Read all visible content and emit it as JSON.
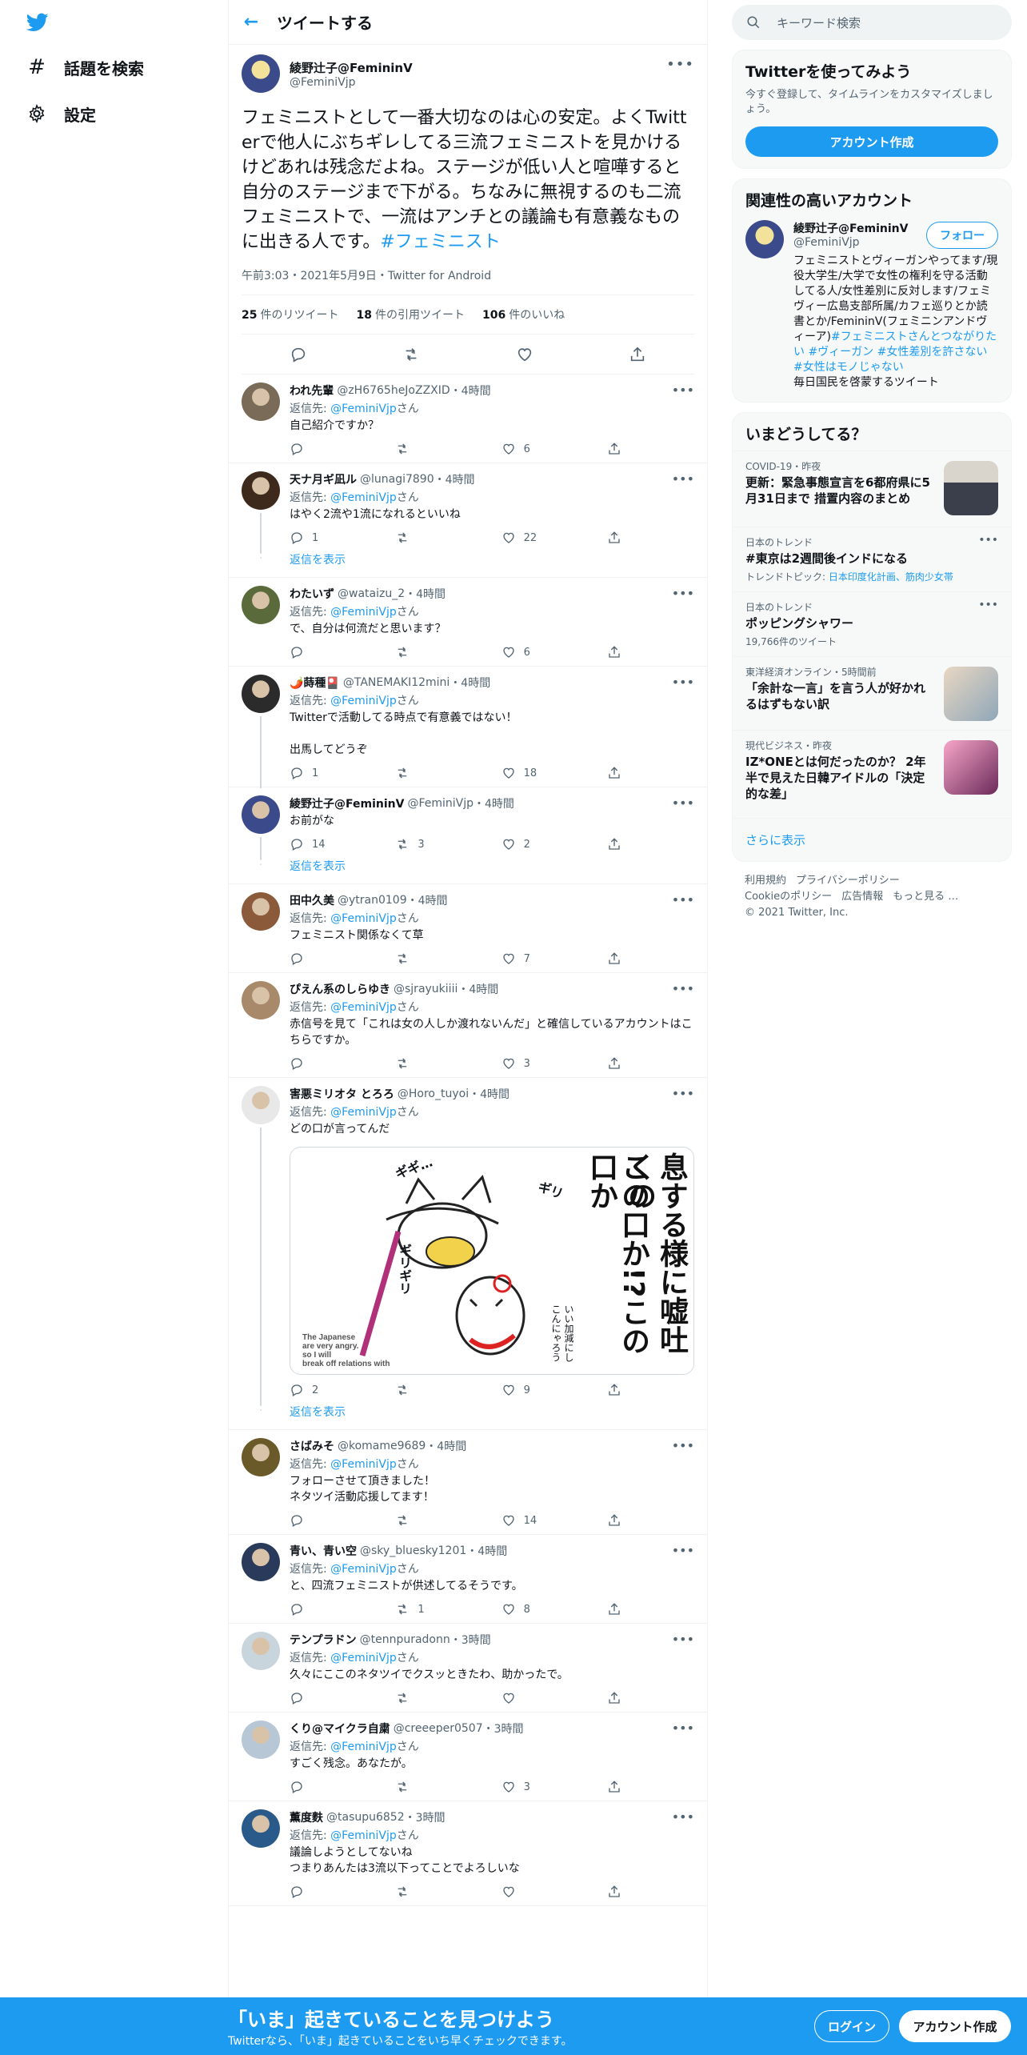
{
  "nav": {
    "explore_label": "話題を検索",
    "settings_label": "設定"
  },
  "header": {
    "title": "ツイートする"
  },
  "main_tweet": {
    "name": "綾野辻子@FemininV",
    "handle": "@FeminiVjp",
    "text": "フェミニストとして一番大切なのは心の安定。よくTwitterで他人にぶちギレしてる三流フェミニストを見かけるけどあれは残念だよね。ステージが低い人と喧嘩すると自分のステージまで下がる。ちなみに無視するのも二流フェミニストで、一流はアンチとの議論も有意義なものに出きる人です。",
    "hashtag": "#フェミニスト",
    "meta": "午前3:03・2021年5月9日・Twitter for Android",
    "retweets_count": "25",
    "retweets_label": "件のリツイート",
    "quotes_count": "18",
    "quotes_label": "件の引用ツイート",
    "likes_count": "106",
    "likes_label": "件のいいね"
  },
  "reply_to_prefix": "返信先:",
  "reply_to_mention": "@FeminiVjp",
  "reply_to_suffix": "さん",
  "show_replies_label": "返信を表示",
  "replies": [
    {
      "name": "われ先輩",
      "handle": "@zH6765heJoZZXID",
      "time": "・4時間",
      "text": "自己紹介ですか？",
      "reply": "",
      "rt": "",
      "like": "6",
      "replyto": true
    },
    {
      "name": "天ナ月ギ凪ル",
      "handle": "@lunagi7890",
      "time": "・4時間",
      "text": "はやく2流や1流になれるといいね",
      "reply": "1",
      "rt": "",
      "like": "22",
      "replyto": true
    },
    {
      "name": "わたいず",
      "handle": "@wataizu_2",
      "time": "・4時間",
      "text": "で、自分は何流だと思います？",
      "reply": "",
      "rt": "",
      "like": "6",
      "replyto": true
    },
    {
      "name": "🌶️蒔種🎴",
      "handle": "@TANEMAKI12mini",
      "time": "・4時間",
      "text": "Twitterで活動してる時点で有意義ではない！\n\n出馬してどうぞ",
      "reply": "1",
      "rt": "",
      "like": "18",
      "replyto": true
    },
    {
      "name": "綾野辻子@FemininV",
      "handle": "@FeminiVjp",
      "time": "・4時間",
      "text": "お前がな",
      "reply": "14",
      "rt": "3",
      "like": "2",
      "replyto": false
    },
    {
      "name": "田中久美",
      "handle": "@ytran0109",
      "time": "・4時間",
      "text": "フェミニスト関係なくて草",
      "reply": "",
      "rt": "",
      "like": "7",
      "replyto": true
    },
    {
      "name": "ぴえん系のしらゆき",
      "handle": "@sjrayukiiii",
      "time": "・4時間",
      "text": "赤信号を見て「これは女の人しか渡れないんだ」と確信しているアカウントはこちらですか。",
      "reply": "",
      "rt": "",
      "like": "3",
      "replyto": true
    },
    {
      "name": "害悪ミリオタ とろろ",
      "handle": "@Horo_tuyoi",
      "time": "・4時間",
      "text": "どの口が言ってんだ",
      "reply": "2",
      "rt": "",
      "like": "9",
      "replyto": true
    },
    {
      "name": "さばみそ",
      "handle": "@komame9689",
      "time": "・4時間",
      "text": "フォローさせて頂きました！\nネタツイ活動応援してます！",
      "reply": "",
      "rt": "",
      "like": "14",
      "replyto": true
    },
    {
      "name": "青い、青い空",
      "handle": "@sky_bluesky1201",
      "time": "・4時間",
      "text": "と、四流フェミニストが供述してるそうです。",
      "reply": "",
      "rt": "1",
      "like": "8",
      "replyto": true
    },
    {
      "name": "テンプラドン",
      "handle": "@tennpuradonn",
      "time": "・3時間",
      "text": "久々にここのネタツイでクスッときたわ、助かったで。",
      "reply": "",
      "rt": "",
      "like": "",
      "replyto": true
    },
    {
      "name": "くり@マイクラ自粛",
      "handle": "@creeeper0507",
      "time": "・3時間",
      "text": "すごく残念。あなたが。",
      "reply": "",
      "rt": "",
      "like": "3",
      "replyto": true
    },
    {
      "name": "薫度麩",
      "handle": "@tasupu6852",
      "time": "・3時間",
      "text": "議論しようとしてないね\nつまりあんたは3流以下ってことでよろしいな",
      "reply": "",
      "rt": "",
      "like": "",
      "replyto": true
    }
  ],
  "media_text": {
    "vertical_1": "息する様に嘘吐くの",
    "vertical_2": "この口か!?この口か",
    "sfx_1": "ギギ…",
    "sfx_2": "ギリ",
    "sfx_3": "ギリギリ",
    "caption": "The Japanese\nare very angry.\nso I will\nbreak off relations with",
    "small_1": "いい加減にし",
    "small_2": "こんにゃろう"
  },
  "right": {
    "search_placeholder": "キーワード検索",
    "signup_title": "Twitterを使ってみよう",
    "signup_sub": "今すぐ登録して、タイムラインをカスタマイズしましょう。",
    "signup_button": "アカウント作成",
    "relevant_title": "関連性の高いアカウント",
    "rel_name": "綾野辻子@FemininV",
    "rel_handle": "@FeminiVjp",
    "follow_label": "フォロー",
    "rel_bio_plain": "フェミニストとヴィーガンやってます/現役大学生/大学で女性の権利を守る活動してる人/女性差別に反対します/フェミヴィー広島支部所属/カフェ巡りとか読書とか/FemininV(フェミニンアンドヴィーア)",
    "rel_bio_tags": "#フェミニストさんとつながりたい #ヴィーガン #女性差別を許さない #女性はモノじゃない",
    "rel_bio_tail": "毎日国民を啓蒙するツイート",
    "trends_title": "いまどうしてる？",
    "trends": [
      {
        "cat": "COVID-19・昨夜",
        "title": "更新：緊急事態宣言を6都府県に5月31日まで 措置内容のまとめ",
        "sub": "",
        "sub_link": ""
      },
      {
        "cat": "日本のトレンド",
        "title": "#東京は2週間後インドになる",
        "sub": "トレンドトピック: ",
        "sub_link": "日本印度化計画、筋肉少女帯"
      },
      {
        "cat": "日本のトレンド",
        "title": "ポッピングシャワー",
        "sub": "19,766件のツイート",
        "sub_link": ""
      },
      {
        "cat": "東洋経済オンライン・5時間前",
        "title": "「余計な一言」を言う人が好かれるはずもない訳",
        "sub": "",
        "sub_link": ""
      },
      {
        "cat": "現代ビジネス・昨夜",
        "title": "IZ*ONEとは何だったのか？ 2年半で見えた日韓アイドルの「決定的な差」",
        "sub": "",
        "sub_link": ""
      }
    ],
    "show_more": "さらに表示",
    "footer": [
      "利用規約",
      "プライバシーポリシー",
      "Cookieのポリシー",
      "広告情報",
      "もっと見る …",
      "© 2021 Twitter, Inc."
    ]
  },
  "bottom": {
    "title": "「いま」起きていることを見つけよう",
    "sub": "Twitterなら、「いま」起きていることをいち早くチェックできます。",
    "login": "ログイン",
    "signup": "アカウント作成"
  }
}
